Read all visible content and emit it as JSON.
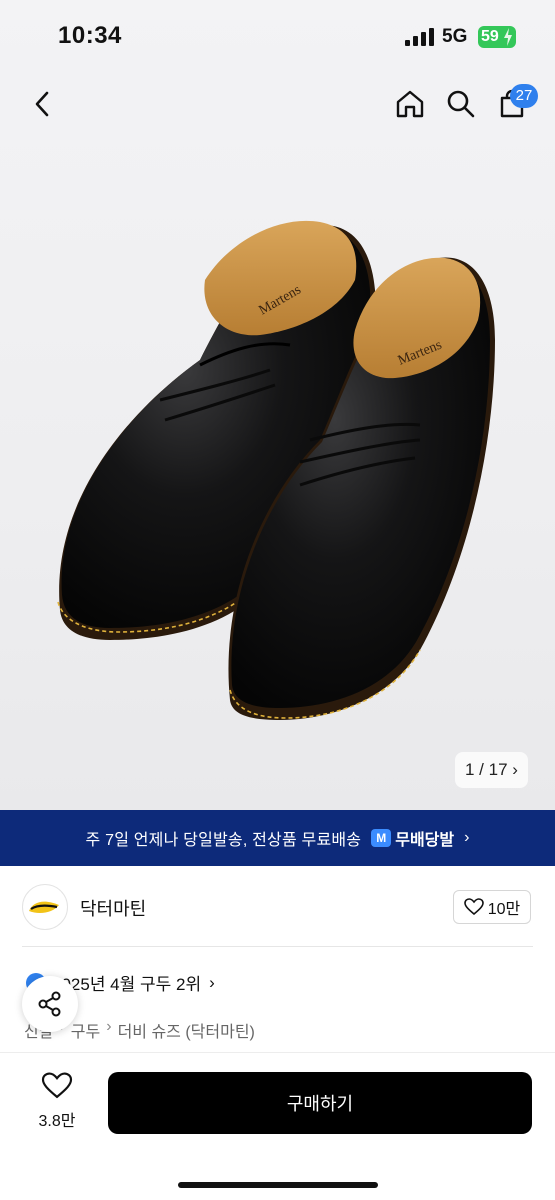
{
  "status": {
    "time": "10:34",
    "network": "5G",
    "battery": "59"
  },
  "nav": {
    "cart_count": "27"
  },
  "gallery": {
    "indicator": "1 / 17",
    "chevron": "›"
  },
  "promo": {
    "text": "주 7일 언제나 당일발송, 전상품 무료배송",
    "logo_mark": "M",
    "logo_text": "무배당발",
    "chevron": "›"
  },
  "brand": {
    "name": "닥터마틴",
    "likes": "10만"
  },
  "ranking": {
    "text": "2025년 4월 구두 2위",
    "chevron": "›"
  },
  "breadcrumb": [
    "신발",
    "구두",
    "더비 슈즈 (닥터마틴)"
  ],
  "breadcrumb_sep": "›",
  "bottom": {
    "wish_count": "3.8만",
    "buy_label": "구매하기"
  },
  "colors": {
    "promo_bg": "#0d2a7a",
    "badge": "#2f80ed",
    "battery": "#34c759",
    "buy_bg": "#000000"
  },
  "icons": [
    "back-icon",
    "home-icon",
    "search-icon",
    "cart-icon",
    "heart-icon",
    "share-icon"
  ]
}
